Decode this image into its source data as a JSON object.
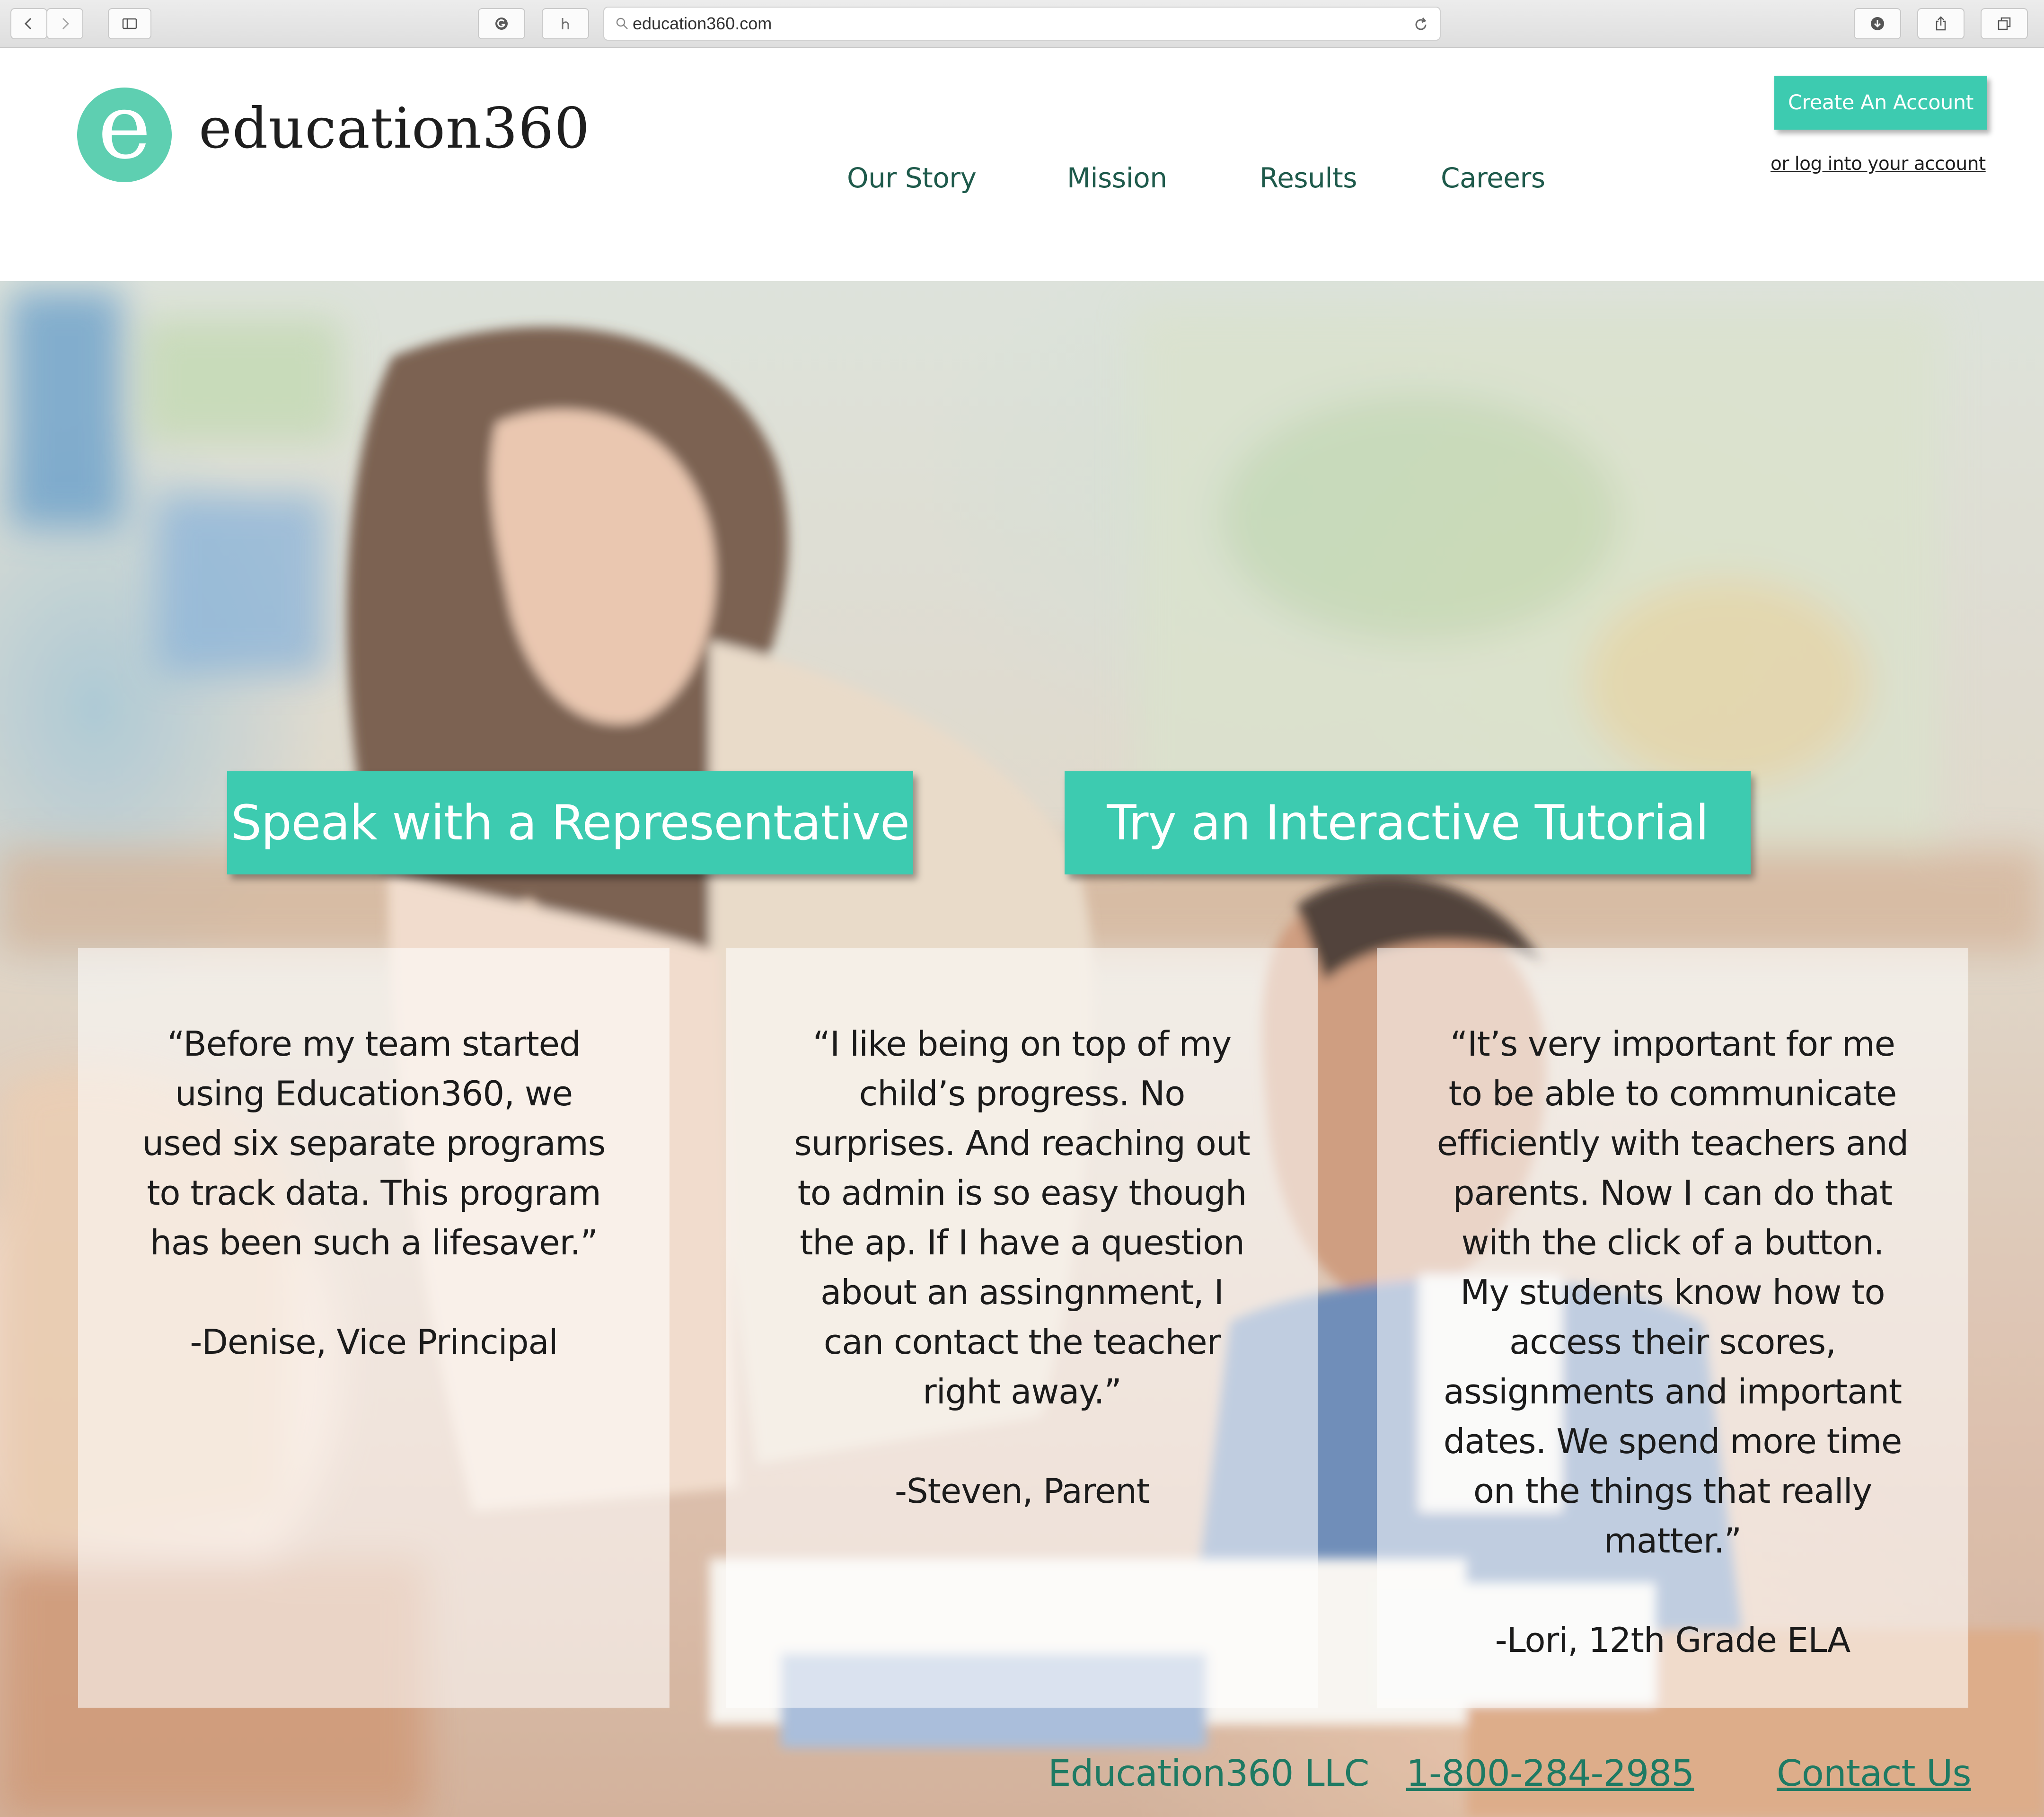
{
  "browser": {
    "url": "education360.com",
    "icons": {
      "back": "chevron-left-icon",
      "forward": "chevron-right-icon",
      "sidebar": "sidebar-icon",
      "extension1": "grammarly-icon",
      "extension2": "honey-icon",
      "search": "search-icon",
      "reload": "reload-icon",
      "download": "download-icon",
      "share": "share-icon",
      "tabs": "tabs-icon"
    }
  },
  "header": {
    "logo_letter": "e",
    "brand": "education360",
    "nav": [
      "Our Story",
      "Mission",
      "Results",
      "Careers"
    ],
    "create_account": "Create An Account",
    "login": "or log into your account"
  },
  "hero": {
    "cta_left": "Speak with a Representative",
    "cta_right": "Try an Interactive Tutorial",
    "testimonials": [
      {
        "quote": "“Before my team started\nusing Education360, we\nused six separate programs\nto track data. This program\nhas been such a lifesaver.”",
        "author": "-Denise, Vice Principal"
      },
      {
        "quote": "“I like being on top of my\nchild’s progress. No\nsurprises. And reaching out\nto admin is so easy though\nthe ap. If I have a question\nabout an assingnment, I\ncan contact the teacher\nright away.”",
        "author": "-Steven, Parent"
      },
      {
        "quote": "“It’s very important for me\nto be able to communicate\nefficiently with teachers and\nparents. Now I can do that\nwith the click of a button.\nMy students know how to\naccess their scores,\nassignments and important\ndates. We spend more time\non the things that really\nmatter.”",
        "author": "-Lori, 12th Grade ELA"
      }
    ]
  },
  "footer": {
    "company": "Education360 LLC",
    "phone": "1-800-284-2985",
    "contact": "Contact Us"
  },
  "colors": {
    "accent": "#3dcbb0",
    "logo": "#5ecfb1",
    "nav_text": "#1e5a4b",
    "footer_text": "#1e7a63"
  }
}
